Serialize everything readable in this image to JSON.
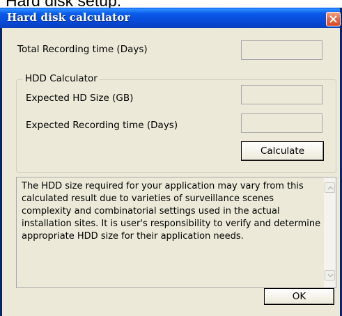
{
  "page": {
    "top_caption": "Hard disk setup."
  },
  "window": {
    "title": "Hard disk calculator",
    "close_symbol": "close-icon"
  },
  "total_recording": {
    "label": "Total Recording time (Days)",
    "value": ""
  },
  "hdd_calculator": {
    "group_label": "HDD Calculator",
    "hd_size": {
      "label": "Expected HD Size (GB)",
      "value": ""
    },
    "recording_time": {
      "label": "Expected Recording time (Days)",
      "value": ""
    },
    "calculate_label": "Calculate"
  },
  "notice": {
    "text": "The HDD size required for your application may vary from this calculated result due to varieties of surveillance scenes complexity and combinatorial settings used in the actual installation sites. It is user's responsibility to verify and determine appropriate HDD size for their application needs."
  },
  "ok_label": "OK",
  "colors": {
    "titlebar": "#0a5ae8",
    "face": "#ece9d8",
    "close": "#e46b47"
  }
}
